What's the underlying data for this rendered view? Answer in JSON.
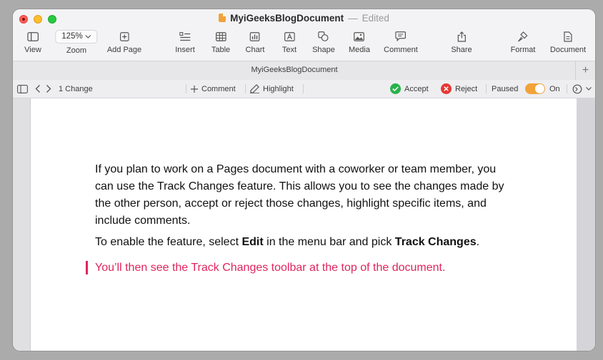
{
  "window": {
    "doc_name": "MyiGeeksBlogDocument",
    "separator": "—",
    "status": "Edited"
  },
  "toolbar": {
    "view": "View",
    "zoom_value": "125%",
    "zoom": "Zoom",
    "add_page": "Add Page",
    "insert": "Insert",
    "table": "Table",
    "chart": "Chart",
    "text": "Text",
    "shape": "Shape",
    "media": "Media",
    "comment": "Comment",
    "share": "Share",
    "format": "Format",
    "document": "Document"
  },
  "tabbar": {
    "title": "MyiGeeksBlogDocument",
    "plus": "+"
  },
  "track": {
    "change_count": "1 Change",
    "comment": "Comment",
    "highlight": "Highlight",
    "accept": "Accept",
    "reject": "Reject",
    "paused": "Paused",
    "on": "On"
  },
  "doc": {
    "para1": "If you plan to work on a Pages document with a coworker or team member, you can use the Track Changes feature. This allows you to see the changes made by the other person, accept or reject those changes, highlight specific items, and include comments.",
    "para2_a": "To enable the feature, select ",
    "para2_b": "Edit",
    "para2_c": " in the menu bar and pick ",
    "para2_d": "Track Changes",
    "para2_e": ".",
    "para3": "You’ll then see the Track Changes toolbar at the top of the document."
  },
  "colors": {
    "accent_orange": "#f1a33a",
    "accept_green": "#27b34a",
    "reject_red": "#e53935",
    "change_pink": "#e0245e"
  }
}
